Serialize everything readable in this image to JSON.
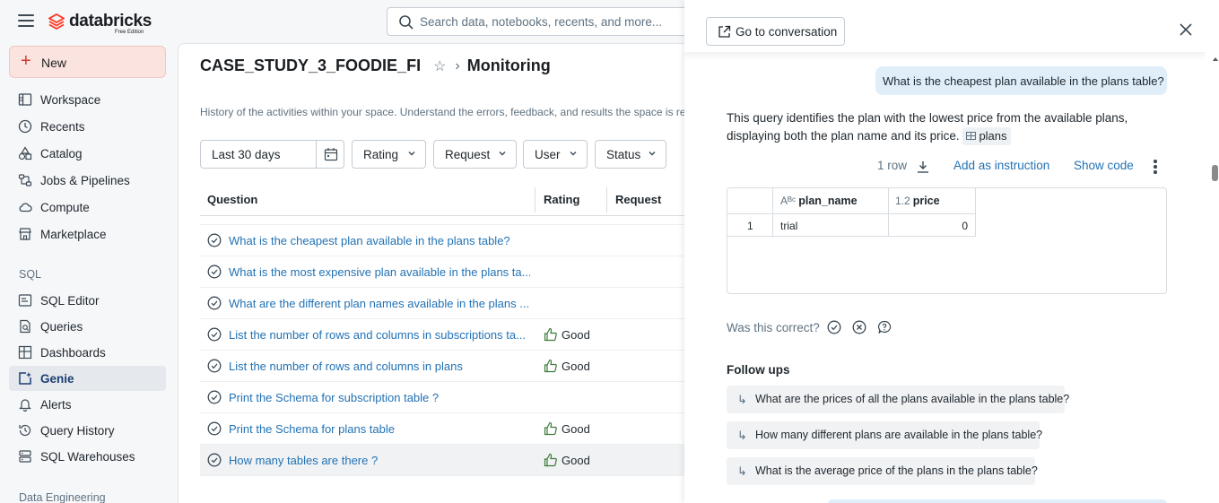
{
  "app": {
    "logo_text": "databricks",
    "logo_sub": "Free Edition",
    "search_placeholder": "Search data, notebooks, recents, and more...",
    "brand_color": "#ff3621"
  },
  "sidebar": {
    "new_label": "New",
    "items": [
      {
        "label": "Workspace",
        "icon": "workspace-icon"
      },
      {
        "label": "Recents",
        "icon": "clock-icon"
      },
      {
        "label": "Catalog",
        "icon": "catalog-icon"
      },
      {
        "label": "Jobs & Pipelines",
        "icon": "workflows-icon"
      },
      {
        "label": "Compute",
        "icon": "cloud-icon"
      },
      {
        "label": "Marketplace",
        "icon": "store-icon"
      }
    ],
    "sql_section": "SQL",
    "sql_items": [
      {
        "label": "SQL Editor",
        "icon": "sql-editor-icon"
      },
      {
        "label": "Queries",
        "icon": "queries-icon"
      },
      {
        "label": "Dashboards",
        "icon": "dashboard-icon"
      },
      {
        "label": "Genie",
        "icon": "genie-icon",
        "active": true
      },
      {
        "label": "Alerts",
        "icon": "bell-icon"
      },
      {
        "label": "Query History",
        "icon": "history-icon"
      },
      {
        "label": "SQL Warehouses",
        "icon": "warehouse-icon"
      }
    ],
    "de_section": "Data Engineering"
  },
  "main": {
    "space_name": "CASE_STUDY_3_FOODIE_FI",
    "page": "Monitoring",
    "description": "History of the activities within your space. Understand the errors, feedback, and results the space is retu",
    "filters": {
      "date": "Last 30 days",
      "rating": "Rating",
      "request": "Request",
      "user": "User",
      "status": "Status"
    },
    "columns": {
      "question": "Question",
      "rating": "Rating",
      "request": "Request"
    },
    "rows": [
      {
        "question": "What is the cheapest plan available in the plans table?",
        "rating": ""
      },
      {
        "question": "What is the most expensive plan available in the plans ta...",
        "rating": ""
      },
      {
        "question": "What are the different plan names available in the plans ...",
        "rating": ""
      },
      {
        "question": "List the number of rows and columns in subscriptions ta...",
        "rating": "Good"
      },
      {
        "question": "List the number of rows and columns in plans",
        "rating": "Good"
      },
      {
        "question": "Print the Schema for subscription table ?",
        "rating": ""
      },
      {
        "question": "Print the Schema for plans table",
        "rating": "Good"
      },
      {
        "question": "How many tables are there ?",
        "rating": "Good"
      }
    ]
  },
  "panel": {
    "goto_label": "Go to conversation",
    "user_message": "What is the cheapest plan available in the plans table?",
    "answer_text": "This query identifies the plan with the lowest price from the available plans, displaying both the plan name and its price.",
    "answer_ref": "plans",
    "row_count": "1 row",
    "add_instruction": "Add as instruction",
    "show_code": "Show code",
    "result": {
      "columns": [
        {
          "type": "Aᴮᶜ",
          "type_icon": "string-type-icon",
          "name": "plan_name"
        },
        {
          "type": "1.2",
          "type_icon": "number-type-icon",
          "name": "price"
        }
      ],
      "rows": [
        {
          "index": "1",
          "plan_name": "trial",
          "price": "0"
        }
      ]
    },
    "was_correct": "Was this correct?",
    "followups_title": "Follow ups",
    "followups": [
      "What are the prices of all the plans available in the plans table?",
      "How many different plans are available in the plans table?",
      "What is the average price of the plans in the plans table?"
    ]
  }
}
